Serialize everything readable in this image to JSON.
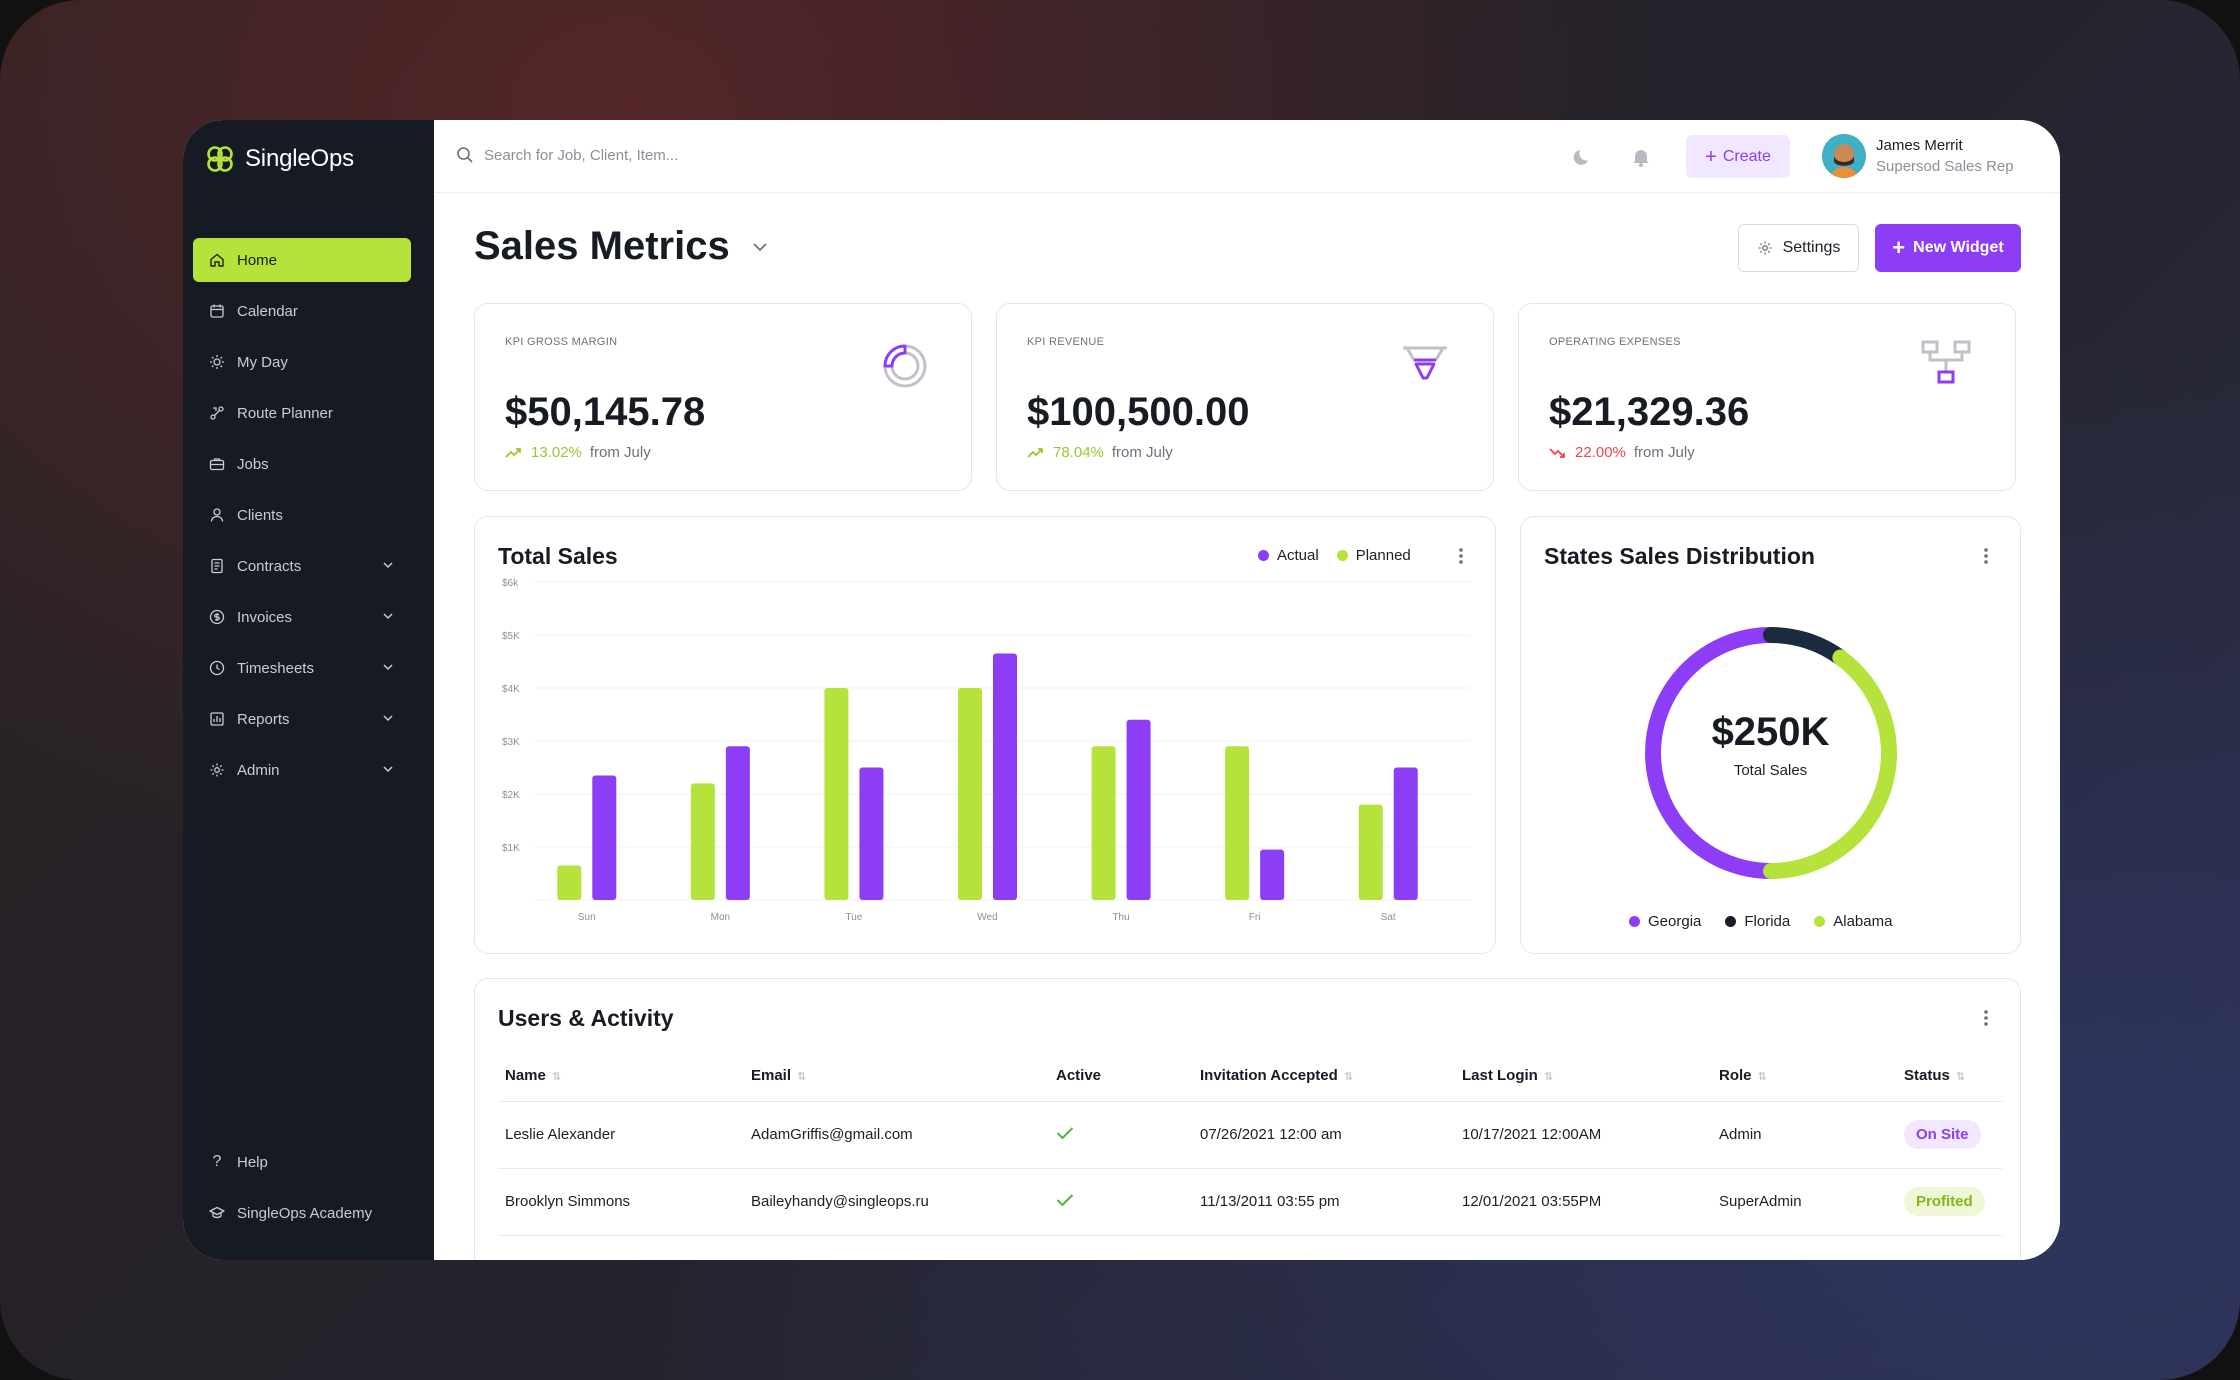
{
  "app": {
    "name": "SingleOps"
  },
  "colors": {
    "accent_green": "#b5e33b",
    "accent_purple": "#8d3df5",
    "sidebar_bg": "#161a23",
    "navy": "#1c2a3f",
    "red": "#ef4350"
  },
  "sidebar": {
    "items": [
      {
        "label": "Home",
        "icon": "home-icon",
        "active": true,
        "has_chevron": false
      },
      {
        "label": "Calendar",
        "icon": "calendar-icon",
        "has_chevron": false
      },
      {
        "label": "My Day",
        "icon": "sun-icon",
        "has_chevron": false
      },
      {
        "label": "Route Planner",
        "icon": "route-icon",
        "has_chevron": false
      },
      {
        "label": "Jobs",
        "icon": "briefcase-icon",
        "has_chevron": false
      },
      {
        "label": "Clients",
        "icon": "user-icon",
        "has_chevron": false
      },
      {
        "label": "Contracts",
        "icon": "document-icon",
        "has_chevron": true
      },
      {
        "label": "Invoices",
        "icon": "dollar-icon",
        "has_chevron": true
      },
      {
        "label": "Timesheets",
        "icon": "clock-icon",
        "has_chevron": true
      },
      {
        "label": "Reports",
        "icon": "chart-icon",
        "has_chevron": true
      },
      {
        "label": "Admin",
        "icon": "gear-icon",
        "has_chevron": true
      }
    ],
    "bottom": [
      {
        "label": "Help",
        "icon": "question-icon"
      },
      {
        "label": "SingleOps Academy",
        "icon": "graduation-icon"
      }
    ]
  },
  "topbar": {
    "search_placeholder": "Search for Job, Client, Item...",
    "create_label": "Create",
    "user": {
      "name": "James Merrit",
      "role": "Supersod Sales Rep"
    }
  },
  "page": {
    "title": "Sales Metrics",
    "settings_label": "Settings",
    "new_widget_label": "New Widget"
  },
  "kpis": [
    {
      "label": "KPI GROSS MARGIN",
      "value": "$50,145.78",
      "change": "13.02%",
      "direction": "up",
      "from": "from July",
      "icon": "donut-chart-icon"
    },
    {
      "label": "KPI REVENUE",
      "value": "$100,500.00",
      "change": "78.04%",
      "direction": "up",
      "from": "from July",
      "icon": "funnel-icon"
    },
    {
      "label": "OPERATING EXPENSES",
      "value": "$21,329.36",
      "change": "22.00%",
      "direction": "down",
      "from": "from July",
      "icon": "hierarchy-icon"
    }
  ],
  "total_sales": {
    "title": "Total Sales",
    "legend": [
      "Actual",
      "Planned"
    ]
  },
  "chart_data": [
    {
      "type": "bar",
      "title": "Total Sales",
      "categories": [
        "Sun",
        "Mon",
        "Tue",
        "Wed",
        "Thu",
        "Fri",
        "Sat"
      ],
      "y_ticks": [
        "$1K",
        "$2K",
        "$3K",
        "$4K",
        "$5K",
        "$6k"
      ],
      "ylim": [
        0,
        6000
      ],
      "series": [
        {
          "name": "Planned",
          "color": "#b5e33b",
          "values": [
            650,
            2200,
            4000,
            4000,
            2900,
            2900,
            1800
          ]
        },
        {
          "name": "Actual",
          "color": "#8d3df5",
          "values": [
            2350,
            2900,
            2500,
            4650,
            3400,
            950,
            2500
          ]
        }
      ],
      "legend_position": "top-right"
    },
    {
      "type": "pie",
      "title": "States Sales Distribution",
      "center_value": "$250K",
      "center_label": "Total Sales",
      "series": [
        {
          "name": "Georgia",
          "color": "#8d3df5",
          "value": 50
        },
        {
          "name": "Florida",
          "color": "#1c2a3f",
          "value": 10
        },
        {
          "name": "Alabama",
          "color": "#b5e33b",
          "value": 40
        }
      ]
    }
  ],
  "users_activity": {
    "title": "Users & Activity",
    "columns": [
      "Name",
      "Email",
      "Active",
      "Invitation Accepted",
      "Last Login",
      "Role",
      "Status"
    ],
    "rows": [
      {
        "name": "Leslie Alexander",
        "email": "AdamGriffis@gmail.com",
        "active": true,
        "invitation": "07/26/2021 12:00 am",
        "last_login": "10/17/2021 12:00AM",
        "role": "Admin",
        "status": "On Site"
      },
      {
        "name": "Brooklyn Simmons",
        "email": "Baileyhandy@singleops.ru",
        "active": true,
        "invitation": "11/13/2011 03:55 pm",
        "last_login": "12/01/2021 03:55PM",
        "role": "SuperAdmin",
        "status": "Profited"
      }
    ]
  }
}
